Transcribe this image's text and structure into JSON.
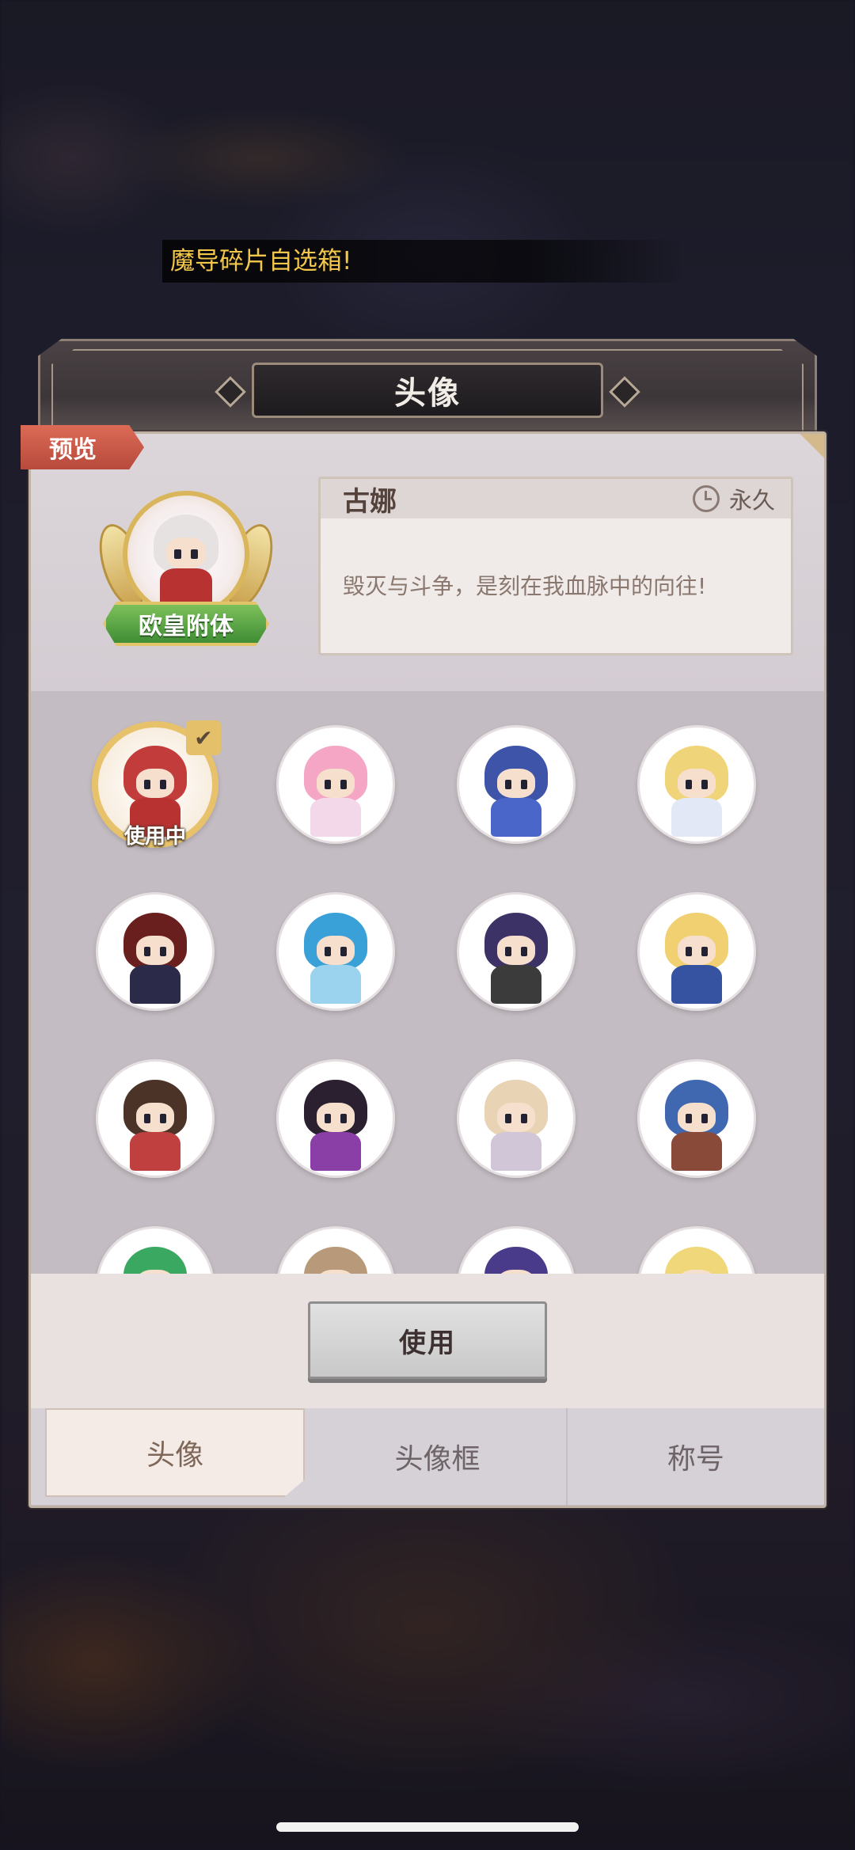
{
  "marquee_text": "魔导碎片自选箱!",
  "dialog": {
    "title": "头像",
    "preview_tag": "预览",
    "selected": {
      "name": "古娜",
      "duration": "永久",
      "description": "毁灭与斗争，是刻在我血脉中的向往!",
      "badge": "欧皇附体"
    },
    "in_use_label": "使用中",
    "use_button": "使用"
  },
  "avatars": [
    {
      "id": "avatar-1",
      "hair": "#c23c3c",
      "body": "#b83232",
      "active": true
    },
    {
      "id": "avatar-2",
      "hair": "#f4a6c4",
      "body": "#f2d8e8"
    },
    {
      "id": "avatar-3",
      "hair": "#3d54a8",
      "body": "#4a66c8"
    },
    {
      "id": "avatar-4",
      "hair": "#f0d47a",
      "body": "#e2e8f6"
    },
    {
      "id": "avatar-5",
      "hair": "#6a1f1f",
      "body": "#2b2a48"
    },
    {
      "id": "avatar-6",
      "hair": "#3aa0d8",
      "body": "#9bd2ee"
    },
    {
      "id": "avatar-7",
      "hair": "#3c3266",
      "body": "#3b3b3b"
    },
    {
      "id": "avatar-8",
      "hair": "#f0d070",
      "body": "#3553a0"
    },
    {
      "id": "avatar-9",
      "hair": "#4b3328",
      "body": "#c04040"
    },
    {
      "id": "avatar-10",
      "hair": "#2a2030",
      "body": "#8a3fa6"
    },
    {
      "id": "avatar-11",
      "hair": "#e8d4b4",
      "body": "#d0c6d8"
    },
    {
      "id": "avatar-12",
      "hair": "#4068b0",
      "body": "#8a4a3a"
    },
    {
      "id": "avatar-13",
      "hair": "#3aa860",
      "body": "#b07a40"
    },
    {
      "id": "avatar-14",
      "hair": "#b89a7a",
      "body": "#6aa24a"
    },
    {
      "id": "avatar-15",
      "hair": "#4a3a8a",
      "body": "#5ac8e8"
    },
    {
      "id": "avatar-16",
      "hair": "#f0d87a",
      "body": "#e07a7a"
    }
  ],
  "tabs": [
    {
      "label": "头像",
      "active": true
    },
    {
      "label": "头像框",
      "active": false
    },
    {
      "label": "称号",
      "active": false
    }
  ]
}
